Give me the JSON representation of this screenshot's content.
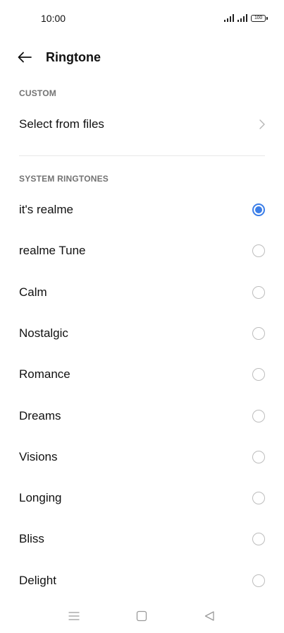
{
  "status_bar": {
    "time": "10:00",
    "battery_level": "100"
  },
  "header": {
    "title": "Ringtone"
  },
  "custom_section": {
    "header": "CUSTOM",
    "select_from_files_label": "Select from files"
  },
  "system_section": {
    "header": "SYSTEM RINGTONES",
    "items": [
      {
        "label": "it's realme",
        "selected": true
      },
      {
        "label": "realme Tune",
        "selected": false
      },
      {
        "label": "Calm",
        "selected": false
      },
      {
        "label": "Nostalgic",
        "selected": false
      },
      {
        "label": "Romance",
        "selected": false
      },
      {
        "label": "Dreams",
        "selected": false
      },
      {
        "label": "Visions",
        "selected": false
      },
      {
        "label": "Longing",
        "selected": false
      },
      {
        "label": "Bliss",
        "selected": false
      },
      {
        "label": "Delight",
        "selected": false
      }
    ]
  },
  "colors": {
    "accent": "#3b7ee8",
    "section_header": "#737373",
    "radio_unselected": "#bdbdbd"
  },
  "icons": {
    "back": "arrow-left-icon",
    "chevron": "chevron-right-icon",
    "nav_menu": "menu-icon",
    "nav_home": "square-home-icon",
    "nav_back": "triangle-back-icon"
  }
}
